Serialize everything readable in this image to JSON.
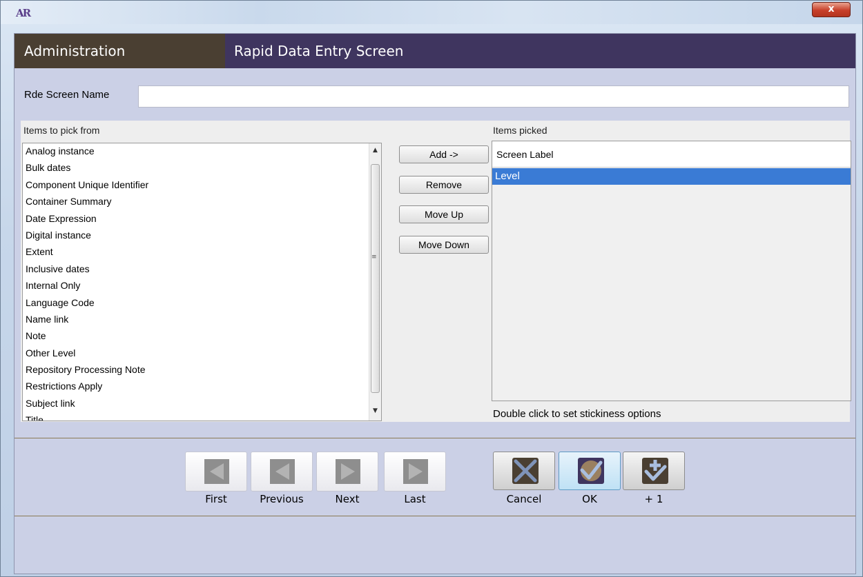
{
  "window": {
    "app_logo": "AR",
    "close_symbol": "x"
  },
  "header": {
    "section": "Administration",
    "title": "Rapid Data Entry Screen"
  },
  "form": {
    "name_label": "Rde Screen Name",
    "name_value": ""
  },
  "picker": {
    "available_label": "Items to pick from",
    "available_items": [
      "Analog instance",
      "Bulk dates",
      "Component Unique Identifier",
      "Container Summary",
      "Date Expression",
      "Digital instance",
      "Extent",
      "Inclusive dates",
      "Internal Only",
      "Language Code",
      "Name link",
      "Note",
      "Other Level",
      "Repository Processing Note",
      "Restrictions Apply",
      "Subject link",
      "Title"
    ],
    "picked_label": "Items picked",
    "picked_column_header": "Screen Label",
    "picked_items": [
      "Level"
    ],
    "hint": "Double click to set stickiness options",
    "buttons": {
      "add": "Add ->",
      "remove": "Remove",
      "move_up": "Move Up",
      "move_down": "Move Down"
    }
  },
  "nav": {
    "first": "First",
    "previous": "Previous",
    "next": "Next",
    "last": "Last"
  },
  "actions": {
    "cancel": "Cancel",
    "ok": "OK",
    "plus_one": "+ 1"
  },
  "icons": {
    "first": "first-arrow-icon",
    "previous": "previous-arrow-icon",
    "next": "next-arrow-icon",
    "last": "last-arrow-icon",
    "cancel": "cancel-x-icon",
    "ok": "ok-check-icon",
    "plus_one": "add-one-icon"
  },
  "colors": {
    "header_bg": "#3f355f",
    "admin_bg": "#4a3f32",
    "selection": "#3a7bd5",
    "client_bg": "#cbd0e6"
  }
}
